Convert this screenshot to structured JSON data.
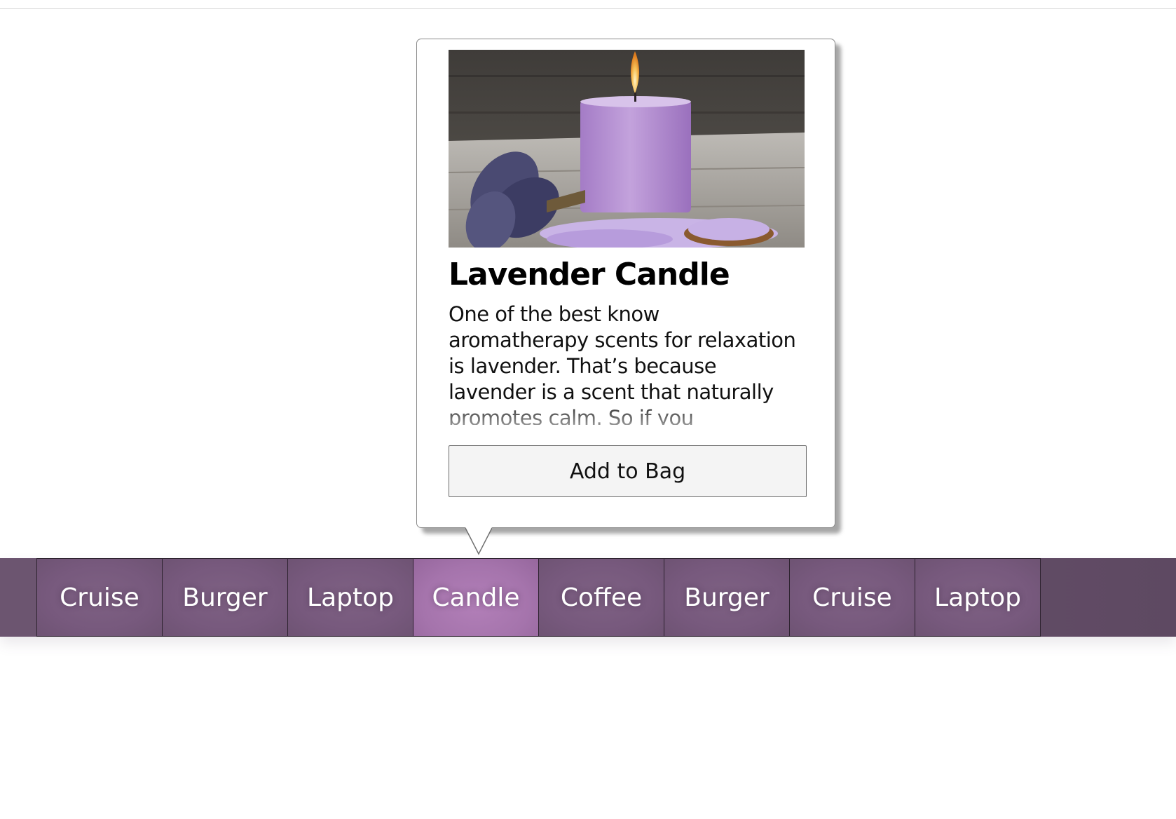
{
  "popover": {
    "image_alt": "Lavender candle with dried lavender and bath salts",
    "title": "Lavender Candle",
    "description": "One of the best know aromatherapy scents for relaxation is lavender. That’s because lavender is a scent that naturally promotes calm. So if you",
    "button_label": "Add to Bag"
  },
  "nav": {
    "active_index": 3,
    "items": [
      {
        "label": "Cruise"
      },
      {
        "label": "Burger"
      },
      {
        "label": "Laptop"
      },
      {
        "label": "Candle"
      },
      {
        "label": "Coffee"
      },
      {
        "label": "Burger"
      },
      {
        "label": "Cruise"
      },
      {
        "label": "Laptop"
      }
    ]
  },
  "colors": {
    "nav_bar": "#6b546f",
    "nav_item": "#77597d",
    "nav_item_active": "#a574ac",
    "button_bg": "#f4f4f4"
  }
}
